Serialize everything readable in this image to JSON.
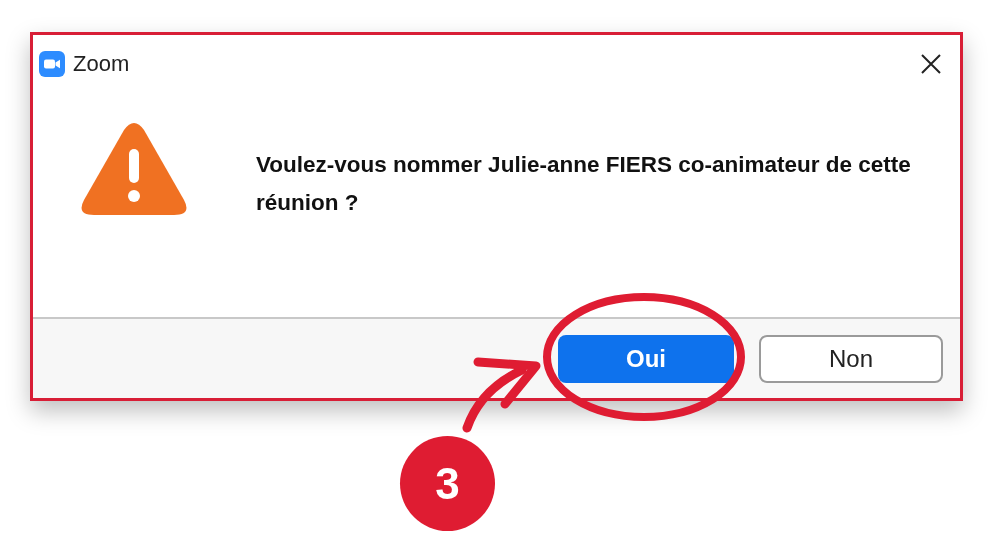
{
  "window": {
    "title": "Zoom"
  },
  "message": "Voulez-vous nommer Julie-anne FIERS co-animateur de cette réunion ?",
  "buttons": [
    {
      "label": "Oui",
      "kind": "primary"
    },
    {
      "label": "Non",
      "kind": "secondary"
    }
  ],
  "callout": {
    "number": "3"
  }
}
